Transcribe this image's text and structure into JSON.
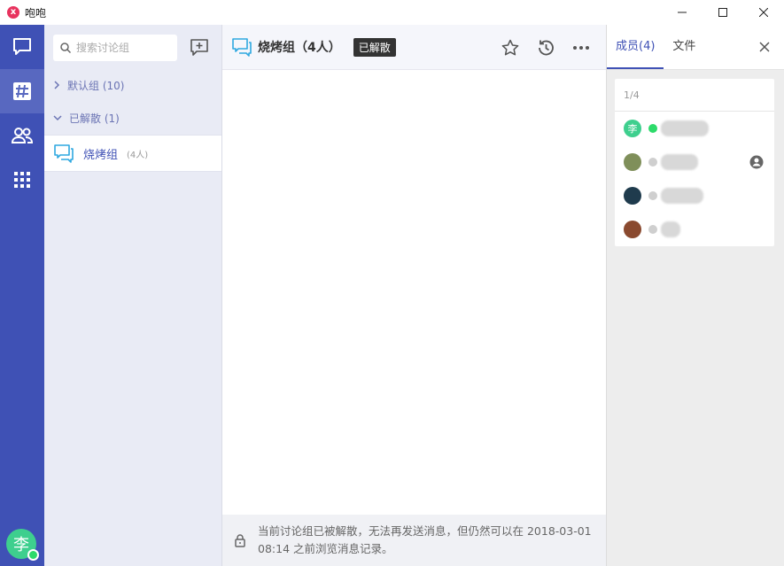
{
  "app": {
    "title": "咆咆",
    "logo_letter": "x"
  },
  "rail": {
    "items": [
      {
        "name": "messages",
        "icon": "chat-icon"
      },
      {
        "name": "groups",
        "icon": "hash-icon",
        "active": true
      },
      {
        "name": "contacts",
        "icon": "contacts-icon"
      },
      {
        "name": "apps",
        "icon": "grid-icon"
      }
    ],
    "user_avatar_text": "李",
    "accent": "#3f51b5"
  },
  "list": {
    "search_placeholder": "搜索讨论组",
    "groups": [
      {
        "label": "默认组 (10)",
        "expanded": false
      },
      {
        "label": "已解散 (1)",
        "expanded": true
      }
    ],
    "conversation": {
      "name": "烧烤组",
      "count": "(4人)"
    }
  },
  "chat": {
    "title": "烧烤组（4人）",
    "badge": "已解散",
    "footer_text": "当前讨论组已被解散，无法再发送消息，但仍然可以在 2018-03-01 08:14 之前浏览消息记录。"
  },
  "right_panel": {
    "tabs": [
      {
        "label": "成员(4)",
        "active": true
      },
      {
        "label": "文件",
        "active": false
      }
    ],
    "member_count": "1/4",
    "members": [
      {
        "avatar_text": "李",
        "avatar_color": "#3ecf8e",
        "status_color": "#2ddb6a",
        "admin": false
      },
      {
        "avatar_text": "",
        "avatar_color": "#7f8f5a",
        "status_color": "#cfcfcf",
        "admin": true
      },
      {
        "avatar_text": "",
        "avatar_color": "#1f3b4d",
        "status_color": "#cfcfcf",
        "admin": false
      },
      {
        "avatar_text": "",
        "avatar_color": "#8a4a2f",
        "status_color": "#cfcfcf",
        "admin": false
      }
    ]
  }
}
